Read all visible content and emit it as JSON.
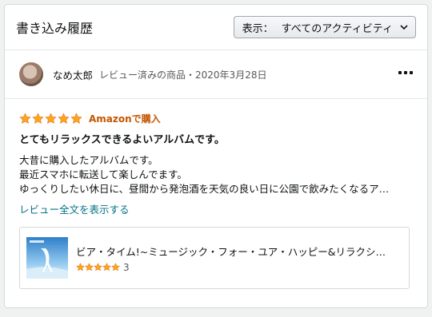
{
  "header": {
    "title": "書き込み履歴",
    "filter_label": "表示：",
    "filter_value": "すべてのアクティビティ"
  },
  "reviewer": {
    "name": "なめ太郎",
    "meta": "レビュー済みの商品・2020年3月28日"
  },
  "review": {
    "stars": 5,
    "verified": "Amazonで購入",
    "title": "とてもリラックスできるよいアルバムです。",
    "lines": [
      "大昔に購入したアルバムです。",
      "最近スマホに転送して楽しんでます。",
      "ゆっくりしたい休日に、昼間から発泡酒を天気の良い日に公園で飲みたくなるア…"
    ],
    "read_more": "レビュー全文を表示する"
  },
  "product": {
    "title": "ビア・タイム!~ミュージック・フォー・ユア・ハッピー&リラクシ…",
    "stars": 5,
    "rating_count": "3"
  },
  "colors": {
    "star": "#ffa41c",
    "link": "#007185",
    "verified": "#c45500"
  }
}
